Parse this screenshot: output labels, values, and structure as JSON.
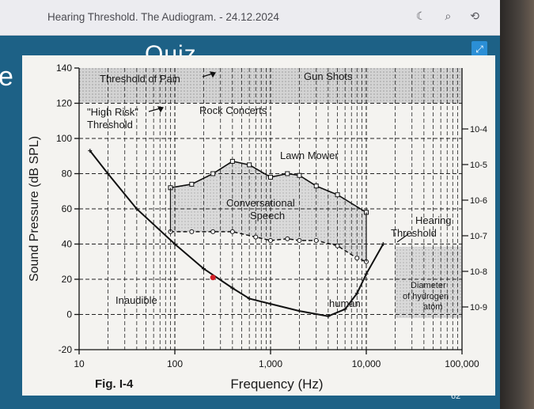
{
  "topbar": {
    "title": "Hearing Threshold. The Audiogram. - 24.12.2024",
    "icons": [
      "moon-icon",
      "search-icon",
      "sync-icon"
    ]
  },
  "slide": {
    "heading": "Quiz",
    "left_letter": "e",
    "expand_icon": "expand-icon",
    "page_number": "62"
  },
  "chart_data": {
    "type": "line",
    "figure_label": "Fig. I-4",
    "xlabel": "Frequency (Hz)",
    "ylabel": "Sound Pressure (dB SPL)",
    "x_scale": "log",
    "xlim": [
      10,
      100000
    ],
    "ylim": [
      -20,
      140
    ],
    "x_ticks": [
      "10",
      "100",
      "1,000",
      "10,000",
      "100,000"
    ],
    "y_ticks": [
      "-20",
      "0",
      "20",
      "40",
      "60",
      "80",
      "100",
      "120",
      "140"
    ],
    "right_ticks": [
      "10-9",
      "10-8",
      "10-7",
      "10-6",
      "10-5",
      "10-4"
    ],
    "grid": true,
    "annotations": {
      "pain": "Threshold of Pain",
      "gunshots": "Gun Shots",
      "high_risk_1": "\"High Risk\"",
      "high_risk_2": "Threshold",
      "rock": "Rock Concerts",
      "lawn": "Lawn Mower",
      "speech_1": "Conversational",
      "speech_2": "Speech",
      "hearing_1": "Hearing",
      "hearing_2": "Threshold",
      "inaudible": "Inaudible",
      "human": "human",
      "diam_1": "Diameter",
      "diam_2": "of hydrogen",
      "diam_3": "atom"
    },
    "series": [
      {
        "name": "Hearing Threshold",
        "points": [
          [
            13,
            93
          ],
          [
            20,
            80
          ],
          [
            40,
            60
          ],
          [
            100,
            40
          ],
          [
            200,
            26
          ],
          [
            400,
            15
          ],
          [
            600,
            9
          ],
          [
            1000,
            6
          ],
          [
            2000,
            2
          ],
          [
            4000,
            -1
          ],
          [
            6000,
            3
          ],
          [
            8000,
            12
          ],
          [
            10000,
            23
          ],
          [
            15000,
            40
          ]
        ]
      },
      {
        "name": "Lawn Mower",
        "points": [
          [
            90,
            72
          ],
          [
            150,
            74
          ],
          [
            250,
            80
          ],
          [
            400,
            87
          ],
          [
            600,
            85
          ],
          [
            1000,
            78
          ],
          [
            1500,
            80
          ],
          [
            2000,
            79
          ],
          [
            3000,
            73
          ],
          [
            5000,
            68
          ],
          [
            10000,
            58
          ]
        ]
      },
      {
        "name": "Conversational Speech",
        "points": [
          [
            90,
            47
          ],
          [
            150,
            47
          ],
          [
            250,
            47
          ],
          [
            400,
            47
          ],
          [
            700,
            44
          ],
          [
            1000,
            42
          ],
          [
            1500,
            43
          ],
          [
            2000,
            42
          ],
          [
            3000,
            42
          ],
          [
            5000,
            39
          ],
          [
            8000,
            32
          ],
          [
            10000,
            30
          ]
        ]
      }
    ],
    "marker": {
      "x": 250,
      "y": 21,
      "color": "#d41f26"
    }
  }
}
